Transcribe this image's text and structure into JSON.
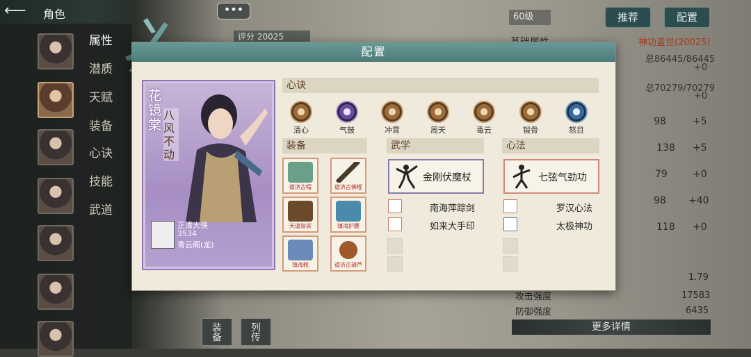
{
  "nav": {
    "back_icon": "back-arrow-icon",
    "title": "角色"
  },
  "menu": [
    "属性",
    "潜质",
    "天赋",
    "装备",
    "心诀",
    "技能",
    "武道"
  ],
  "chat": {
    "label": "•••"
  },
  "score": {
    "text": "评分 20025"
  },
  "right": {
    "level": "60级",
    "recommend": "推荐",
    "config": "配置",
    "basic_label": "基础属性",
    "title_value": "神功盖世(20025)",
    "hp": "总86445/86445",
    "hp_delta": "+0",
    "mp": "总70279/70279",
    "mp_delta": "+0",
    "rows": [
      {
        "val": "98",
        "delta": "+5"
      },
      {
        "val": "138",
        "delta": "+5"
      },
      {
        "val": "79",
        "delta": "+0"
      },
      {
        "val": "98",
        "delta": "+40"
      },
      {
        "val": "118",
        "delta": "+0"
      }
    ],
    "speed_val": "1.79",
    "attack_label": "攻击强度",
    "attack_val": "17583",
    "defense_label": "防御强度",
    "defense_val": "6435",
    "more": "更多详情"
  },
  "bottom_tabs": {
    "equip": "装备",
    "biography": "列传"
  },
  "modal": {
    "title": "配置",
    "character": {
      "name": "花镜棠",
      "motto": "八风不动",
      "player_name": "正清大侠",
      "player_score": "3534",
      "guild": "青云阁(龙)"
    },
    "xinjue_header": "心诀",
    "xinjue": [
      {
        "label": "清心",
        "color": "gold"
      },
      {
        "label": "气鼓",
        "color": "purple"
      },
      {
        "label": "冲霄",
        "color": "gold"
      },
      {
        "label": "周天",
        "color": "gold"
      },
      {
        "label": "毒云",
        "color": "gold"
      },
      {
        "label": "锻骨",
        "color": "gold"
      },
      {
        "label": "怒目",
        "color": "blue"
      }
    ],
    "equip_header": "装备",
    "equipment": [
      {
        "label": "道济古帽"
      },
      {
        "label": "道济古佛棍"
      },
      {
        "label": "天道袈裟"
      },
      {
        "label": "镇海护腰"
      },
      {
        "label": "镇海靴"
      },
      {
        "label": "道济古葫芦"
      }
    ],
    "wuxue_header": "武学",
    "wuxue_main": "金刚伏魔杖",
    "wuxue_list": [
      "南海萍踪剑",
      "如来大手印"
    ],
    "xinfa_header": "心法",
    "xinfa_main": "七弦气劲功",
    "xinfa_list": [
      "罗汉心法",
      "太极神功"
    ]
  }
}
